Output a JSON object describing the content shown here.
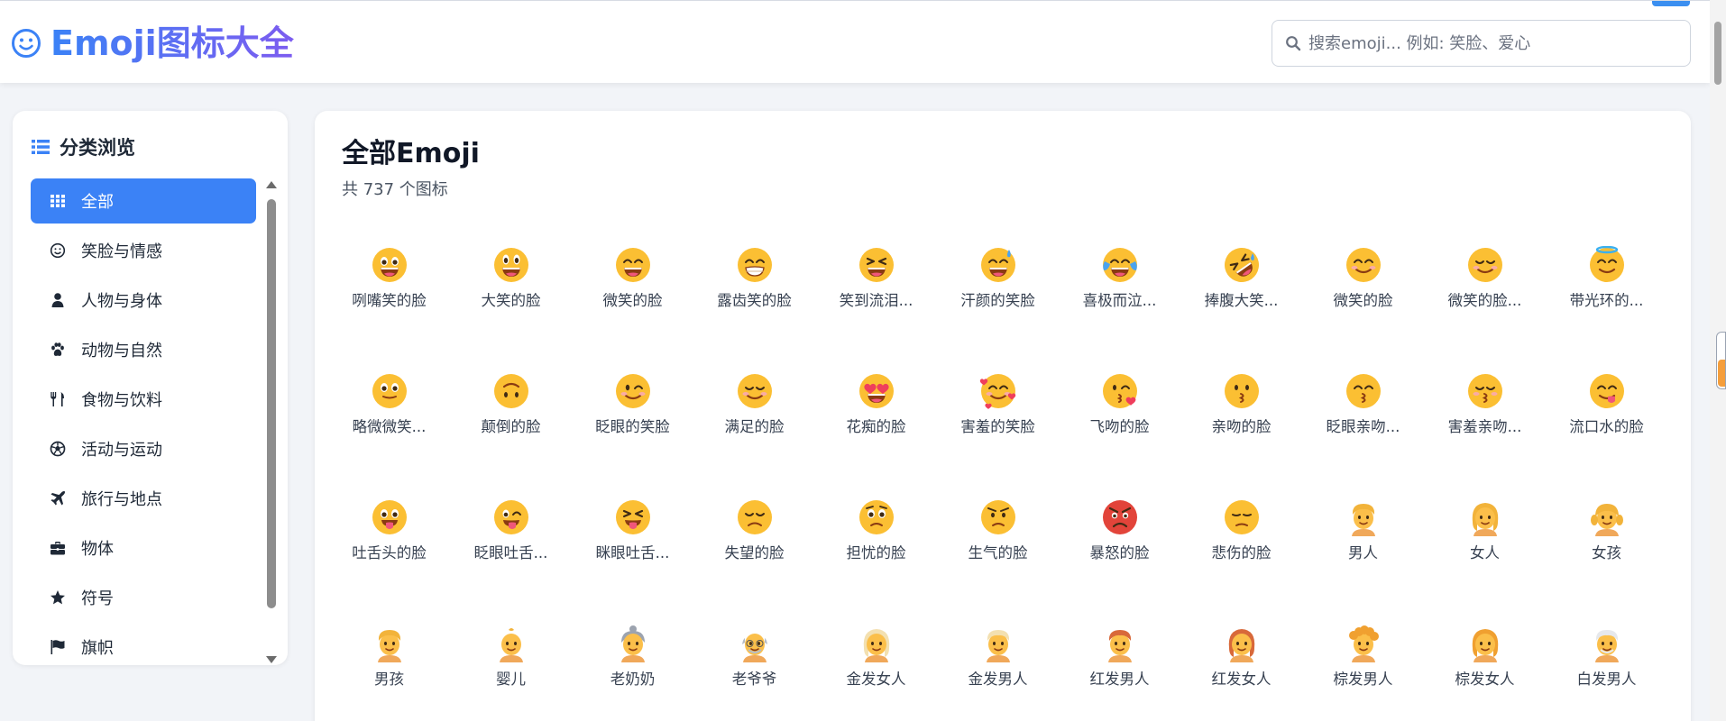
{
  "header": {
    "title": "Emoji图标大全",
    "search_placeholder": "搜索emoji... 例如: 笑脸、爱心"
  },
  "sidebar": {
    "title": "分类浏览",
    "items": [
      {
        "label": "全部",
        "icon": "grid-icon",
        "active": true
      },
      {
        "label": "笑脸与情感",
        "icon": "smile-icon"
      },
      {
        "label": "人物与身体",
        "icon": "user-icon"
      },
      {
        "label": "动物与自然",
        "icon": "paw-icon"
      },
      {
        "label": "食物与饮料",
        "icon": "utensils-icon"
      },
      {
        "label": "活动与运动",
        "icon": "soccer-ball-icon"
      },
      {
        "label": "旅行与地点",
        "icon": "plane-icon"
      },
      {
        "label": "物体",
        "icon": "briefcase-icon"
      },
      {
        "label": "符号",
        "icon": "star-icon"
      },
      {
        "label": "旗帜",
        "icon": "flag-icon"
      }
    ]
  },
  "main": {
    "title": "全部Emoji",
    "count_text": "共 737 个图标",
    "emojis": [
      {
        "label": "咧嘴笑的脸",
        "kind": "face",
        "feature": "grin-open"
      },
      {
        "label": "大笑的脸",
        "kind": "face",
        "feature": "big-eyes-open"
      },
      {
        "label": "微笑的脸",
        "kind": "face",
        "feature": "smile-eyes-open"
      },
      {
        "label": "露齿笑的脸",
        "kind": "face",
        "feature": "beam"
      },
      {
        "label": "笑到流泪...",
        "kind": "face",
        "feature": "squint-open"
      },
      {
        "label": "汗颜的笑脸",
        "kind": "face",
        "feature": "sweat"
      },
      {
        "label": "喜极而泣...",
        "kind": "face",
        "feature": "tears"
      },
      {
        "label": "捧腹大笑...",
        "kind": "face",
        "feature": "rofl"
      },
      {
        "label": "微笑的脸",
        "kind": "face",
        "feature": "blush"
      },
      {
        "label": "微笑的脸...",
        "kind": "face",
        "feature": "smile-closed"
      },
      {
        "label": "带光环的...",
        "kind": "face",
        "feature": "halo"
      },
      {
        "label": "略微微笑...",
        "kind": "face",
        "feature": "slight"
      },
      {
        "label": "颠倒的脸",
        "kind": "face",
        "feature": "upside"
      },
      {
        "label": "眨眼的笑脸",
        "kind": "face",
        "feature": "wink"
      },
      {
        "label": "满足的脸",
        "kind": "face",
        "feature": "relieved"
      },
      {
        "label": "花痴的脸",
        "kind": "face",
        "feature": "heart-eyes"
      },
      {
        "label": "害羞的笑脸",
        "kind": "face",
        "feature": "hearts"
      },
      {
        "label": "飞吻的脸",
        "kind": "face",
        "feature": "kiss-heart"
      },
      {
        "label": "亲吻的脸",
        "kind": "face",
        "feature": "kiss"
      },
      {
        "label": "眨眼亲吻...",
        "kind": "face",
        "feature": "kiss-closed"
      },
      {
        "label": "害羞亲吻...",
        "kind": "face",
        "feature": "kiss-blush"
      },
      {
        "label": "流口水的脸",
        "kind": "face",
        "feature": "yum"
      },
      {
        "label": "吐舌头的脸",
        "kind": "face",
        "feature": "tongue"
      },
      {
        "label": "眨眼吐舌...",
        "kind": "face",
        "feature": "wink-tongue"
      },
      {
        "label": "眯眼吐舌...",
        "kind": "face",
        "feature": "squint-tongue"
      },
      {
        "label": "失望的脸",
        "kind": "face",
        "feature": "disappointed"
      },
      {
        "label": "担忧的脸",
        "kind": "face",
        "feature": "worried"
      },
      {
        "label": "生气的脸",
        "kind": "face",
        "feature": "angry"
      },
      {
        "label": "暴怒的脸",
        "kind": "face",
        "feature": "rage"
      },
      {
        "label": "悲伤的脸",
        "kind": "face",
        "feature": "pensive"
      },
      {
        "label": "男人",
        "kind": "person",
        "feature": "man"
      },
      {
        "label": "女人",
        "kind": "person",
        "feature": "woman"
      },
      {
        "label": "女孩",
        "kind": "person",
        "feature": "girl"
      },
      {
        "label": "男孩",
        "kind": "person",
        "feature": "boy"
      },
      {
        "label": "婴儿",
        "kind": "person",
        "feature": "baby"
      },
      {
        "label": "老奶奶",
        "kind": "person",
        "feature": "old-woman"
      },
      {
        "label": "老爷爷",
        "kind": "person",
        "feature": "old-man"
      },
      {
        "label": "金发女人",
        "kind": "person",
        "feature": "blond-woman"
      },
      {
        "label": "金发男人",
        "kind": "person",
        "feature": "blond-man"
      },
      {
        "label": "红发男人",
        "kind": "person",
        "feature": "red-man"
      },
      {
        "label": "红发女人",
        "kind": "person",
        "feature": "red-woman"
      },
      {
        "label": "棕发男人",
        "kind": "person",
        "feature": "curly-man"
      },
      {
        "label": "棕发女人",
        "kind": "person",
        "feature": "curly-woman"
      },
      {
        "label": "白发男人",
        "kind": "person",
        "feature": "white-man"
      }
    ]
  },
  "colors": {
    "accent": "#3b82f6",
    "title_gradient_end": "#7c5cf0",
    "face_yellow": "#fbbf33",
    "face_rage": "#e2443a"
  }
}
